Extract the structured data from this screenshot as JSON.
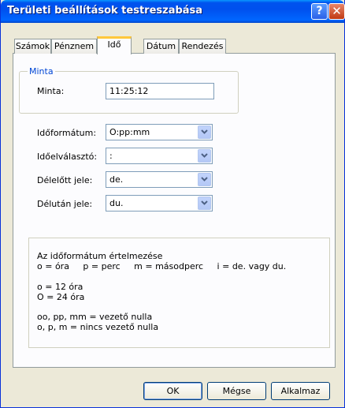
{
  "window": {
    "title": "Területi beállítások testreszabása",
    "help_label": "?",
    "close_label": "✕"
  },
  "tabs": [
    {
      "label": "Számok"
    },
    {
      "label": "Pénznem"
    },
    {
      "label": "Idő"
    },
    {
      "label": "Dátum"
    },
    {
      "label": "Rendezés"
    }
  ],
  "sample": {
    "group_label": "Minta",
    "label": "Minta:",
    "value": "11:25:12"
  },
  "fields": {
    "time_format": {
      "label": "Időformátum:",
      "value": "O:pp:mm"
    },
    "time_separator": {
      "label": "Időelválasztó:",
      "value": ":"
    },
    "am_symbol": {
      "label": "Délelőtt jele:",
      "value": "de."
    },
    "pm_symbol": {
      "label": "Délután jele:",
      "value": "du."
    }
  },
  "info": {
    "title": "Az időformátum értelmezése",
    "legend": "o = óra     p = perc     m = másodperc     i = de. vagy du.",
    "line_12h": "o = 12 óra",
    "line_24h": "O = 24 óra",
    "line_leading_zero": "oo, pp, mm = vezető nulla",
    "line_no_leading_zero": "o, p, m = nincs vezető nulla"
  },
  "buttons": {
    "ok": "OK",
    "cancel": "Mégse",
    "apply": "Alkalmaz"
  }
}
